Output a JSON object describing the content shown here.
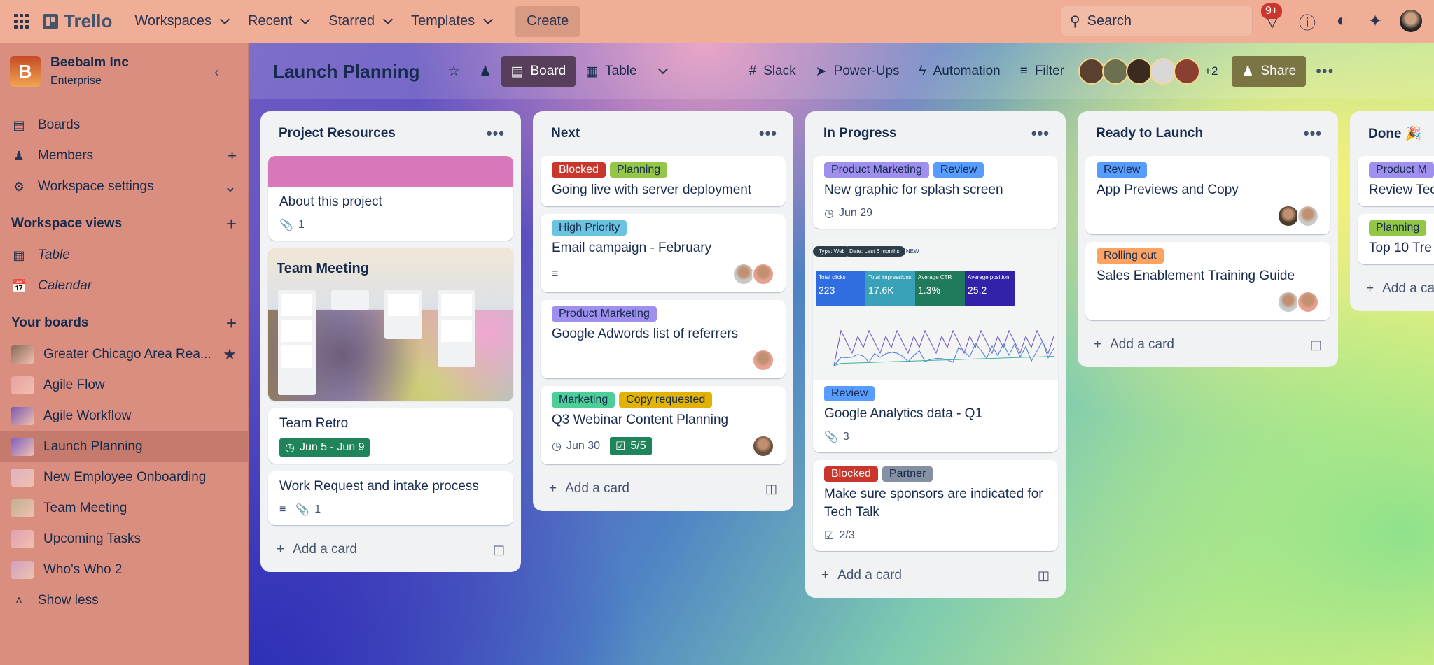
{
  "topnav": {
    "logo": "Trello",
    "menus": [
      "Workspaces",
      "Recent",
      "Starred",
      "Templates"
    ],
    "create": "Create",
    "search_placeholder": "Search",
    "notifications_badge": "9+"
  },
  "sidebar": {
    "workspace_name": "Beebalm Inc",
    "workspace_initial": "B",
    "workspace_plan": "Enterprise",
    "nav": [
      {
        "label": "Boards",
        "icon": "board-icon"
      },
      {
        "label": "Members",
        "icon": "person-icon"
      },
      {
        "label": "Workspace settings",
        "icon": "gear-icon"
      }
    ],
    "views_heading": "Workspace views",
    "views": [
      {
        "label": "Table",
        "icon": "table-icon"
      },
      {
        "label": "Calendar",
        "icon": "calendar-icon"
      }
    ],
    "boards_heading": "Your boards",
    "boards": [
      {
        "label": "Greater Chicago Area Rea...",
        "color": "#8a6a5a",
        "starred": true
      },
      {
        "label": "Agile Flow",
        "color": "#e9a0a0"
      },
      {
        "label": "Agile Workflow",
        "color": "#7a5ab0"
      },
      {
        "label": "Launch Planning",
        "color": "#8060c0",
        "active": true
      },
      {
        "label": "New Employee Onboarding",
        "color": "#e0b0c0"
      },
      {
        "label": "Team Meeting",
        "color": "#c0b090"
      },
      {
        "label": "Upcoming Tasks",
        "color": "#e0a0b0"
      },
      {
        "label": "Who's Who 2",
        "color": "#d0a0c0"
      }
    ],
    "show_less": "Show less"
  },
  "board": {
    "title": "Launch Planning",
    "views": [
      "Board",
      "Table"
    ],
    "actions": [
      "Slack",
      "Power-Ups",
      "Automation",
      "Filter"
    ],
    "extra_members": "+2",
    "share": "Share",
    "add_card": "Add a card",
    "lists": [
      {
        "title": "Project Resources",
        "cards": [
          {
            "cover": "pink",
            "title": "About this project",
            "attachments": "1"
          },
          {
            "cover_title": "Team Meeting",
            "type": "fullcover"
          },
          {
            "title": "Team Retro",
            "date": "Jun 5 - Jun 9",
            "date_done": true
          },
          {
            "title": "Work Request and intake process",
            "description": true,
            "attachments": "1"
          }
        ]
      },
      {
        "title": "Next",
        "cards": [
          {
            "labels": [
              {
                "text": "Blocked",
                "color": "#c9372c",
                "fg": "#fff"
              },
              {
                "text": "Planning",
                "color": "#94c748"
              }
            ],
            "title": "Going live with server deployment"
          },
          {
            "labels": [
              {
                "text": "High Priority",
                "color": "#6cc3e0"
              }
            ],
            "title": "Email campaign - February",
            "description": true,
            "members": 2
          },
          {
            "labels": [
              {
                "text": "Product Marketing",
                "color": "#9f8fef"
              }
            ],
            "title": "Google Adwords list of referrers",
            "members": 1
          },
          {
            "labels": [
              {
                "text": "Marketing",
                "color": "#4bce97"
              },
              {
                "text": "Copy requested",
                "color": "#e2b203"
              }
            ],
            "title": "Q3 Webinar Content Planning",
            "date": "Jun 30",
            "checklist": "5/5",
            "checklist_done": true,
            "members": 1
          }
        ]
      },
      {
        "title": "In Progress",
        "cards": [
          {
            "labels": [
              {
                "text": "Product Marketing",
                "color": "#9f8fef"
              },
              {
                "text": "Review",
                "color": "#579dff"
              }
            ],
            "title": "New graphic for splash screen",
            "date": "Jun 29"
          },
          {
            "image": "analytics",
            "image_text": {
              "chips": [
                "Type: Web",
                "Date: Last 6 months",
                "+ NEW"
              ],
              "tiles": [
                [
                  "Total clicks",
                  "223"
                ],
                [
                  "Total impressions",
                  "17.6K"
                ],
                [
                  "Average CTR",
                  "1.3%"
                ],
                [
                  "Average position",
                  "25.2"
                ]
              ]
            },
            "labels": [
              {
                "text": "Review",
                "color": "#579dff"
              }
            ],
            "title": "Google Analytics data - Q1",
            "attachments": "3"
          },
          {
            "labels": [
              {
                "text": "Blocked",
                "color": "#c9372c",
                "fg": "#fff"
              },
              {
                "text": "Partner",
                "color": "#8590a2"
              }
            ],
            "title": "Make sure sponsors are indicated for Tech Talk",
            "checklist": "2/3"
          }
        ]
      },
      {
        "title": "Ready to Launch",
        "cards": [
          {
            "labels": [
              {
                "text": "Review",
                "color": "#579dff"
              }
            ],
            "title": "App Previews and Copy",
            "members": 2
          },
          {
            "labels": [
              {
                "text": "Rolling out",
                "color": "#fea362"
              }
            ],
            "title": "Sales Enablement Training Guide",
            "members": 2
          }
        ]
      },
      {
        "title": "Done 🎉",
        "cards": [
          {
            "labels": [
              {
                "text": "Product M",
                "color": "#9f8fef"
              }
            ],
            "title": "Review Tec"
          },
          {
            "labels": [
              {
                "text": "Planning",
                "color": "#94c748"
              }
            ],
            "title": "Top 10 Tre"
          }
        ]
      }
    ]
  }
}
